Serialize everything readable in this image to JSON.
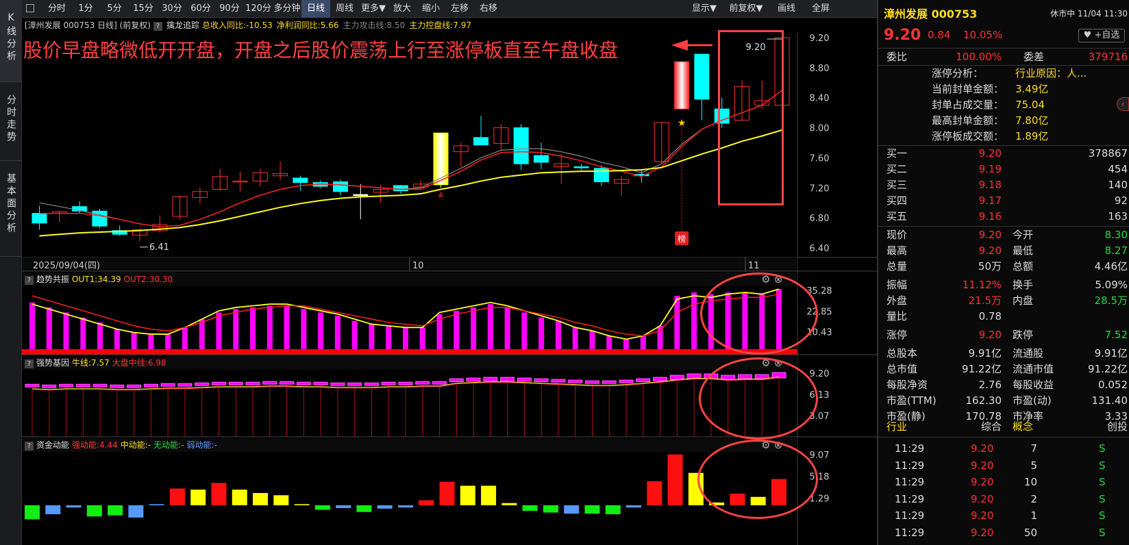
{
  "side_tabs": [
    "K线分析",
    "分时走势",
    "基本面分析"
  ],
  "toolbar": {
    "left": [
      "分时",
      "1分",
      "5分",
      "15分",
      "30分",
      "60分",
      "90分",
      "120分",
      "多分钟",
      "日线",
      "周线",
      "更多▼",
      "放大",
      "缩小",
      "左移",
      "右移"
    ],
    "active": "日线",
    "right": [
      "显示▼",
      "前复权▼",
      "画线",
      "全屏"
    ]
  },
  "indicator_bar": {
    "title": "[漳州发展 000753 日线] (前复权)",
    "qmark": "?",
    "name": "擒龙追踪",
    "items": [
      {
        "label": "总收入同比:-10.53",
        "color": "#ffdd22"
      },
      {
        "label": "净利润同比:5.66",
        "color": "#ffdd22"
      },
      {
        "label": "主力攻击线:8.50",
        "color": "#888888"
      },
      {
        "label": "主力控盘线:7.97",
        "color": "#ffdd22"
      }
    ]
  },
  "annotation": "股价早盘略微低开开盘，开盘之后股价震荡上行至涨停板直至午盘收盘",
  "chart_data": {
    "type": "candlestick",
    "price_axis": [
      "9.20",
      "8.80",
      "8.40",
      "8.00",
      "7.60",
      "7.20",
      "6.80",
      "6.40"
    ],
    "date_labels": [
      "2025/09/04(四)",
      "10",
      "11"
    ],
    "markers": {
      "low_label": "6.41",
      "high_label": "9.20",
      "rank_badge": "榜"
    },
    "candles": [
      {
        "o": 6.73,
        "h": 6.96,
        "l": 6.64,
        "c": 6.86,
        "col": "c"
      },
      {
        "o": 6.86,
        "h": 6.9,
        "l": 6.74,
        "c": 6.88,
        "col": "r"
      },
      {
        "o": 6.95,
        "h": 7.02,
        "l": 6.86,
        "c": 6.89,
        "col": "c"
      },
      {
        "o": 6.89,
        "h": 6.92,
        "l": 6.66,
        "c": 6.69,
        "col": "c"
      },
      {
        "o": 6.63,
        "h": 6.7,
        "l": 6.56,
        "c": 6.58,
        "col": "c"
      },
      {
        "o": 6.57,
        "h": 6.66,
        "l": 6.49,
        "c": 6.64,
        "col": "r"
      },
      {
        "o": 6.63,
        "h": 6.83,
        "l": 6.6,
        "c": 6.71,
        "col": "r"
      },
      {
        "o": 6.82,
        "h": 7.1,
        "l": 6.78,
        "c": 7.08,
        "col": "r"
      },
      {
        "o": 7.07,
        "h": 7.2,
        "l": 6.99,
        "c": 7.15,
        "col": "r"
      },
      {
        "o": 7.18,
        "h": 7.45,
        "l": 7.16,
        "c": 7.35,
        "col": "r"
      },
      {
        "o": 7.28,
        "h": 7.42,
        "l": 7.15,
        "c": 7.29,
        "col": "r"
      },
      {
        "o": 7.29,
        "h": 7.45,
        "l": 7.22,
        "c": 7.4,
        "col": "r"
      },
      {
        "o": 7.36,
        "h": 7.55,
        "l": 7.3,
        "c": 7.39,
        "col": "r"
      },
      {
        "o": 7.33,
        "h": 7.36,
        "l": 7.16,
        "c": 7.27,
        "col": "c"
      },
      {
        "o": 7.27,
        "h": 7.3,
        "l": 7.2,
        "c": 7.22,
        "col": "c"
      },
      {
        "o": 7.28,
        "h": 7.31,
        "l": 7.1,
        "c": 7.15,
        "col": "c"
      },
      {
        "o": 7.11,
        "h": 7.25,
        "l": 6.78,
        "c": 7.11,
        "col": "w"
      },
      {
        "o": 7.14,
        "h": 7.24,
        "l": 7.0,
        "c": 7.18,
        "col": "r"
      },
      {
        "o": 7.16,
        "h": 7.24,
        "l": 7.12,
        "c": 7.23,
        "col": "c"
      },
      {
        "o": 7.21,
        "h": 7.3,
        "l": 7.2,
        "c": 7.25,
        "col": "r"
      },
      {
        "o": 7.24,
        "h": 7.93,
        "l": 7.2,
        "c": 7.93,
        "col": "y"
      },
      {
        "o": 7.68,
        "h": 7.8,
        "l": 7.48,
        "c": 7.76,
        "col": "r"
      },
      {
        "o": 7.87,
        "h": 8.16,
        "l": 7.77,
        "c": 7.77,
        "col": "c"
      },
      {
        "o": 7.79,
        "h": 8.05,
        "l": 7.7,
        "c": 8.0,
        "col": "r"
      },
      {
        "o": 8.0,
        "h": 8.05,
        "l": 7.44,
        "c": 7.52,
        "col": "c"
      },
      {
        "o": 7.63,
        "h": 7.8,
        "l": 7.45,
        "c": 7.54,
        "col": "c"
      },
      {
        "o": 7.52,
        "h": 7.65,
        "l": 7.25,
        "c": 7.48,
        "col": "r"
      },
      {
        "o": 7.48,
        "h": 7.52,
        "l": 7.44,
        "c": 7.48,
        "col": "c"
      },
      {
        "o": 7.46,
        "h": 7.5,
        "l": 7.22,
        "c": 7.28,
        "col": "c"
      },
      {
        "o": 7.26,
        "h": 7.36,
        "l": 7.09,
        "c": 7.31,
        "col": "r"
      },
      {
        "o": 7.38,
        "h": 7.45,
        "l": 7.27,
        "c": 7.36,
        "col": "c"
      },
      {
        "o": 7.55,
        "h": 8.07,
        "l": 7.52,
        "c": 8.07,
        "col": "r"
      },
      {
        "o": 8.25,
        "h": 8.88,
        "l": 8.24,
        "c": 8.88,
        "col": "g"
      },
      {
        "o": 8.98,
        "h": 8.98,
        "l": 8.1,
        "c": 8.38,
        "col": "c"
      },
      {
        "o": 8.25,
        "h": 8.4,
        "l": 8.0,
        "c": 8.06,
        "col": "c"
      },
      {
        "o": 8.1,
        "h": 8.63,
        "l": 8.1,
        "c": 8.55,
        "col": "r"
      },
      {
        "o": 8.3,
        "h": 8.63,
        "l": 8.25,
        "c": 8.36,
        "col": "r"
      },
      {
        "o": 8.3,
        "h": 9.2,
        "l": 8.27,
        "c": 9.2,
        "col": "r"
      }
    ],
    "ma_yellow": [
      6.56,
      6.58,
      6.6,
      6.61,
      6.62,
      6.63,
      6.65,
      6.67,
      6.71,
      6.76,
      6.82,
      6.88,
      6.94,
      6.99,
      7.03,
      7.06,
      7.08,
      7.09,
      7.1,
      7.12,
      7.18,
      7.23,
      7.29,
      7.34,
      7.37,
      7.4,
      7.41,
      7.42,
      7.42,
      7.43,
      7.44,
      7.47,
      7.56,
      7.65,
      7.73,
      7.82,
      7.89,
      7.97
    ],
    "ma_red": [
      6.86,
      6.86,
      6.86,
      6.83,
      6.78,
      6.72,
      6.68,
      6.7,
      6.78,
      6.88,
      7.0,
      7.1,
      7.18,
      7.23,
      7.25,
      7.24,
      7.22,
      7.2,
      7.18,
      7.18,
      7.3,
      7.42,
      7.57,
      7.67,
      7.68,
      7.67,
      7.62,
      7.56,
      7.48,
      7.42,
      7.35,
      7.48,
      7.75,
      7.98,
      8.1,
      8.2,
      8.3,
      8.5
    ],
    "ma_gray": [
      7.0,
      6.95,
      6.9,
      6.84,
      6.78,
      6.72,
      6.68,
      6.7,
      6.78,
      6.88,
      7.0,
      7.1,
      7.18,
      7.23,
      7.25,
      7.24,
      7.22,
      7.2,
      7.18,
      7.2,
      7.33,
      7.46,
      7.6,
      7.7,
      7.72,
      7.72,
      7.68,
      7.62,
      7.54,
      7.48,
      7.4,
      7.52,
      7.78,
      7.98,
      8.1,
      8.2,
      8.3,
      8.5
    ],
    "trend_panel": {
      "qmark": "?",
      "name": "趋势共振",
      "out1": "OUT1:34.39",
      "out2": "OUT2:30.30",
      "axis": [
        "35.28",
        "22.85",
        "10.43"
      ],
      "bars": [
        28,
        25,
        22,
        19,
        16,
        12,
        10,
        9,
        9,
        13,
        18,
        22,
        24,
        25,
        26,
        26,
        24,
        22,
        20,
        17,
        15,
        14,
        13,
        13,
        21,
        23,
        25,
        27,
        25,
        22,
        19,
        17,
        13,
        11,
        8,
        6,
        8,
        14,
        32,
        34,
        33,
        34,
        34,
        33,
        36
      ],
      "line1": [
        27,
        24,
        21,
        18,
        15,
        12,
        10,
        9,
        9,
        13,
        18,
        23,
        25,
        26,
        27,
        27,
        25,
        23,
        21,
        18,
        15,
        14,
        13,
        13,
        22,
        24,
        26,
        28,
        26,
        23,
        20,
        17,
        13,
        11,
        8,
        6,
        8,
        14,
        30,
        32,
        31,
        33,
        34,
        33,
        36
      ],
      "line2": [
        32,
        29,
        26,
        23,
        20,
        17,
        14,
        12,
        11,
        13,
        16,
        20,
        22,
        24,
        25,
        26,
        26,
        24,
        22,
        20,
        18,
        16,
        15,
        14,
        18,
        21,
        23,
        25,
        25,
        23,
        21,
        19,
        16,
        14,
        11,
        9,
        8,
        11,
        22,
        27,
        29,
        30,
        31,
        31,
        33
      ]
    },
    "strong_panel": {
      "qmark": "?",
      "name": "强势基因",
      "niu": "牛线:7.57",
      "dapan": "大盘中线:6.98",
      "axis": [
        "9.20",
        "6.13",
        "3.07"
      ],
      "levels": [
        7.3,
        7.2,
        7.3,
        7.3,
        7.3,
        7.2,
        7.2,
        7.3,
        7.4,
        7.4,
        7.5,
        7.6,
        7.6,
        7.6,
        7.7,
        7.7,
        7.6,
        7.6,
        7.5,
        7.5,
        7.5,
        7.6,
        7.6,
        7.7,
        7.7,
        8.1,
        8.2,
        8.3,
        8.3,
        8.2,
        8.1,
        8.0,
        7.9,
        7.8,
        7.8,
        7.9,
        8.1,
        8.3,
        8.6,
        8.8,
        8.8,
        8.6,
        8.7,
        8.7,
        9.0
      ]
    },
    "money_panel": {
      "qmark": "?",
      "name": "资金动能",
      "strong": "强动能:4.44",
      "mid": "中动能:-",
      "none": "无动能:-",
      "weak": "弱动能:-",
      "axis": [
        "9.07",
        "5.18",
        "1.29"
      ],
      "bars": [
        {
          "v": -2.5,
          "c": "g"
        },
        {
          "v": -1.6,
          "c": "b"
        },
        {
          "v": -0.4,
          "c": "b"
        },
        {
          "v": -2.0,
          "c": "g"
        },
        {
          "v": -1.8,
          "c": "g"
        },
        {
          "v": -2.2,
          "c": "b"
        },
        {
          "v": 0.2,
          "c": "b"
        },
        {
          "v": 3.0,
          "c": "r"
        },
        {
          "v": 2.8,
          "c": "y"
        },
        {
          "v": 4.0,
          "c": "r"
        },
        {
          "v": 2.8,
          "c": "y"
        },
        {
          "v": 2.2,
          "c": "y"
        },
        {
          "v": 1.8,
          "c": "y"
        },
        {
          "v": 0.2,
          "c": "y"
        },
        {
          "v": -0.8,
          "c": "g"
        },
        {
          "v": -0.5,
          "c": "b"
        },
        {
          "v": -1.2,
          "c": "g"
        },
        {
          "v": -0.6,
          "c": "b"
        },
        {
          "v": -0.4,
          "c": "b"
        },
        {
          "v": 0.9,
          "c": "r"
        },
        {
          "v": 4.2,
          "c": "r"
        },
        {
          "v": 3.5,
          "c": "y"
        },
        {
          "v": 3.5,
          "c": "y"
        },
        {
          "v": 0.4,
          "c": "y"
        },
        {
          "v": -1.0,
          "c": "g"
        },
        {
          "v": -1.3,
          "c": "g"
        },
        {
          "v": -1.5,
          "c": "b"
        },
        {
          "v": -1.5,
          "c": "g"
        },
        {
          "v": -1.6,
          "c": "g"
        },
        {
          "v": -0.4,
          "c": "b"
        },
        {
          "v": 4.3,
          "c": "r"
        },
        {
          "v": 9.1,
          "c": "r"
        },
        {
          "v": 5.8,
          "c": "y"
        },
        {
          "v": 0.5,
          "c": "y"
        },
        {
          "v": 2.1,
          "c": "r"
        },
        {
          "v": 1.5,
          "c": "y"
        },
        {
          "v": 4.7,
          "c": "r"
        }
      ]
    }
  },
  "right_panel": {
    "name": "漳州发展",
    "code": "000753",
    "status": "休市中 11/04 11:30",
    "price": "9.20",
    "change": "0.84",
    "pct": "10.05%",
    "watch_btn": "+自选",
    "weibi_label": "委比",
    "weibi": "100.00%",
    "weicha_label": "委差",
    "weicha": "379716",
    "limit_info": [
      {
        "k": "涨停分析：",
        "v": "行业原因：人..."
      },
      {
        "k": "当前封单金额：",
        "v": "3.49亿"
      },
      {
        "k": "封单占成交量：",
        "v": "75.04"
      },
      {
        "k": "最高封单金额：",
        "v": "7.80亿"
      },
      {
        "k": "涨停板成交额：",
        "v": "1.89亿"
      }
    ],
    "bids": [
      {
        "k": "买一",
        "p": "9.20",
        "v": "378867"
      },
      {
        "k": "买二",
        "p": "9.19",
        "v": "454"
      },
      {
        "k": "买三",
        "p": "9.18",
        "v": "140"
      },
      {
        "k": "买四",
        "p": "9.17",
        "v": "92"
      },
      {
        "k": "买五",
        "p": "9.16",
        "v": "163"
      }
    ],
    "stats": [
      [
        {
          "k": "现价",
          "v": "9.20",
          "c": "red"
        },
        {
          "k": "今开",
          "v": "8.30",
          "c": "green"
        }
      ],
      [
        {
          "k": "最高",
          "v": "9.20",
          "c": "red"
        },
        {
          "k": "最低",
          "v": "8.27",
          "c": "green"
        }
      ],
      [
        {
          "k": "总量",
          "v": "50万",
          "c": "white"
        },
        {
          "k": "总额",
          "v": "4.46亿",
          "c": "white"
        }
      ],
      [
        {
          "k": "振幅",
          "v": "11.12%",
          "c": "red"
        },
        {
          "k": "换手",
          "v": "5.09%",
          "c": "white"
        }
      ],
      [
        {
          "k": "外盘",
          "v": "21.5万",
          "c": "red"
        },
        {
          "k": "内盘",
          "v": "28.5万",
          "c": "green"
        }
      ],
      [
        {
          "k": "量比",
          "v": "0.78",
          "c": "white"
        },
        {
          "k": "",
          "v": "",
          "c": "white"
        }
      ],
      [
        {
          "k": "涨停",
          "v": "9.20",
          "c": "red"
        },
        {
          "k": "跌停",
          "v": "7.52",
          "c": "green"
        }
      ],
      [
        {
          "k": "总股本",
          "v": "9.91亿",
          "c": "white"
        },
        {
          "k": "流通股",
          "v": "9.91亿",
          "c": "white"
        }
      ],
      [
        {
          "k": "总市值",
          "v": "91.22亿",
          "c": "white"
        },
        {
          "k": "流通市值",
          "v": "91.22亿",
          "c": "white"
        }
      ],
      [
        {
          "k": "每股净资",
          "v": "2.76",
          "c": "white"
        },
        {
          "k": "每股收益",
          "v": "0.052",
          "c": "white"
        }
      ],
      [
        {
          "k": "市盈(TTM)",
          "v": "162.30",
          "c": "white"
        },
        {
          "k": "市盈(动)",
          "v": "131.40",
          "c": "white"
        }
      ],
      [
        {
          "k": "市盈(静)",
          "v": "170.78",
          "c": "white"
        },
        {
          "k": "市净率",
          "v": "3.33",
          "c": "white"
        }
      ]
    ],
    "industry": {
      "k1": "行业",
      "v1": "综合",
      "k2": "概念",
      "v2": "创投"
    },
    "trades": [
      {
        "t": "11:29",
        "p": "9.20",
        "v": "7",
        "d": "S"
      },
      {
        "t": "11:29",
        "p": "9.20",
        "v": "5",
        "d": "S"
      },
      {
        "t": "11:29",
        "p": "9.20",
        "v": "10",
        "d": "S"
      },
      {
        "t": "11:29",
        "p": "9.20",
        "v": "2",
        "d": "S"
      },
      {
        "t": "11:29",
        "p": "9.20",
        "v": "1",
        "d": "S"
      },
      {
        "t": "11:29",
        "p": "9.20",
        "v": "50",
        "d": "S"
      }
    ]
  }
}
